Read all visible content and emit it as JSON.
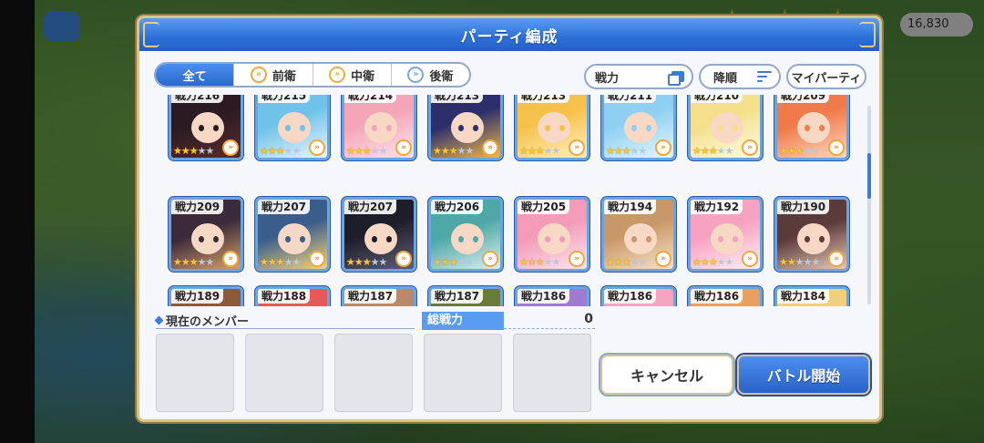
{
  "dialog": {
    "title": "パーティ編成"
  },
  "filters": {
    "tabs": [
      {
        "label": "全て",
        "active": true
      },
      {
        "label": "前衛",
        "active": false
      },
      {
        "label": "中衛",
        "active": false
      },
      {
        "label": "後衛",
        "active": false
      }
    ],
    "power_label": "戦力",
    "sort_label": "降順",
    "my_party_label": "マイパーティ"
  },
  "characters": [
    {
      "label": "戦力216",
      "stars": 3
    },
    {
      "label": "戦力215",
      "stars": 3
    },
    {
      "label": "戦力214",
      "stars": 3
    },
    {
      "label": "戦力213",
      "stars": 3
    },
    {
      "label": "戦力213",
      "stars": 3
    },
    {
      "label": "戦力211",
      "stars": 3
    },
    {
      "label": "戦力210",
      "stars": 3
    },
    {
      "label": "戦力209",
      "stars": 3
    },
    {
      "label": "戦力209",
      "stars": 3
    },
    {
      "label": "戦力207",
      "stars": 3
    },
    {
      "label": "戦力207",
      "stars": 3
    },
    {
      "label": "戦力206",
      "stars": 3
    },
    {
      "label": "戦力205",
      "stars": 3
    },
    {
      "label": "戦力194",
      "stars": 3
    },
    {
      "label": "戦力192",
      "stars": 3
    },
    {
      "label": "戦力190",
      "stars": 2
    },
    {
      "label": "戦力189",
      "stars": 0
    },
    {
      "label": "戦力188",
      "stars": 0
    },
    {
      "label": "戦力187",
      "stars": 0
    },
    {
      "label": "戦力187",
      "stars": 0
    },
    {
      "label": "戦力186",
      "stars": 0
    },
    {
      "label": "戦力186",
      "stars": 0
    },
    {
      "label": "戦力186",
      "stars": 0
    },
    {
      "label": "戦力184",
      "stars": 0
    }
  ],
  "members": {
    "title": "現在のメンバー",
    "slots": 5
  },
  "total": {
    "label": "総戦力",
    "value": "0"
  },
  "buttons": {
    "cancel": "キャンセル",
    "start": "バトル開始"
  },
  "background": {
    "gold": "16,830"
  }
}
